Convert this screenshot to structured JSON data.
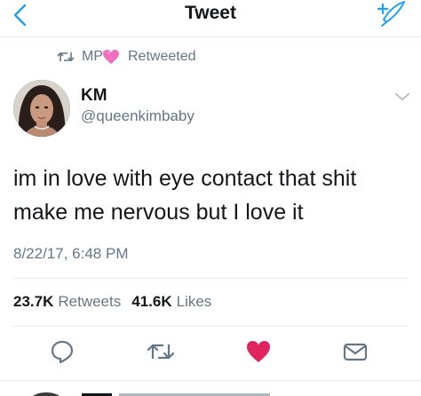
{
  "nav": {
    "title": "Tweet",
    "back_icon": "chevron-left-icon",
    "compose_icon": "compose-tweet-icon",
    "accent_color": "#1da1f2"
  },
  "retweet_context": {
    "icon": "retweet-icon",
    "user": "MP",
    "emoji_icon": "pink-heart-emoji",
    "label": "Retweeted"
  },
  "tweet": {
    "display_name": "KM",
    "handle": "@queenkimbaby",
    "text_line1": "im in love with eye contact that shit",
    "text_line2": "make me nervous but I love it",
    "timestamp": "8/22/17, 6:48 PM"
  },
  "stats": {
    "retweets_count": "23.7K",
    "retweets_label": "Retweets",
    "likes_count": "41.6K",
    "likes_label": "Likes"
  },
  "actions": {
    "reply_icon": "reply-icon",
    "retweet_icon": "retweet-icon",
    "like_icon": "heart-icon",
    "like_color": "#e0245e",
    "dm_icon": "envelope-icon"
  },
  "colors": {
    "text_primary": "#14171a",
    "text_secondary": "#657786",
    "divider": "#e6ecf0"
  }
}
